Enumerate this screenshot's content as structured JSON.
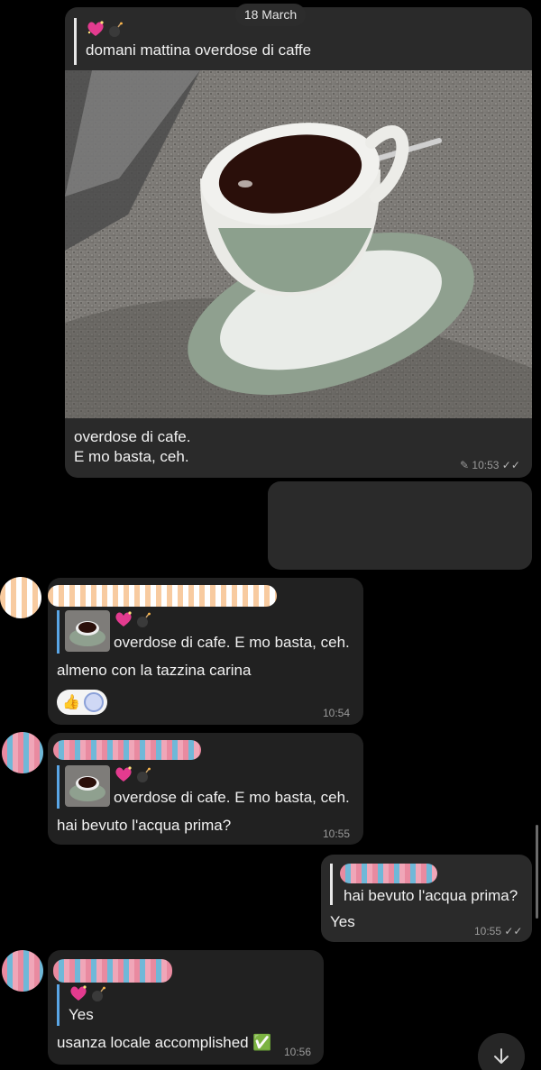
{
  "date_chip": "18 March",
  "msg1": {
    "reply_quote": "domani mattina overdose di caffe",
    "caption_line1": "overdose di cafe.",
    "caption_line2": "E mo basta, ceh.",
    "time": "10:53"
  },
  "msg3": {
    "reply_quote": "overdose di cafe. E mo basta, ceh.",
    "text": "almeno con la tazzina carina",
    "time": "10:54"
  },
  "msg4": {
    "reply_quote": "overdose di cafe. E mo basta, ceh.",
    "text": "hai bevuto l'acqua prima?",
    "time": "10:55"
  },
  "msg5": {
    "reply_quote": "hai bevuto l'acqua prima?",
    "text": "Yes",
    "time": "10:55"
  },
  "msg6": {
    "reply_quote": "Yes",
    "text": "usanza locale accomplished ✅",
    "time": "10:56"
  },
  "icons": {
    "edited": "pencil-icon",
    "read": "double-check-icon",
    "scroll": "arrow-down-icon"
  },
  "colors": {
    "background": "#000000",
    "bubble": "#212121",
    "reply_bar": "#5aa6e6"
  }
}
